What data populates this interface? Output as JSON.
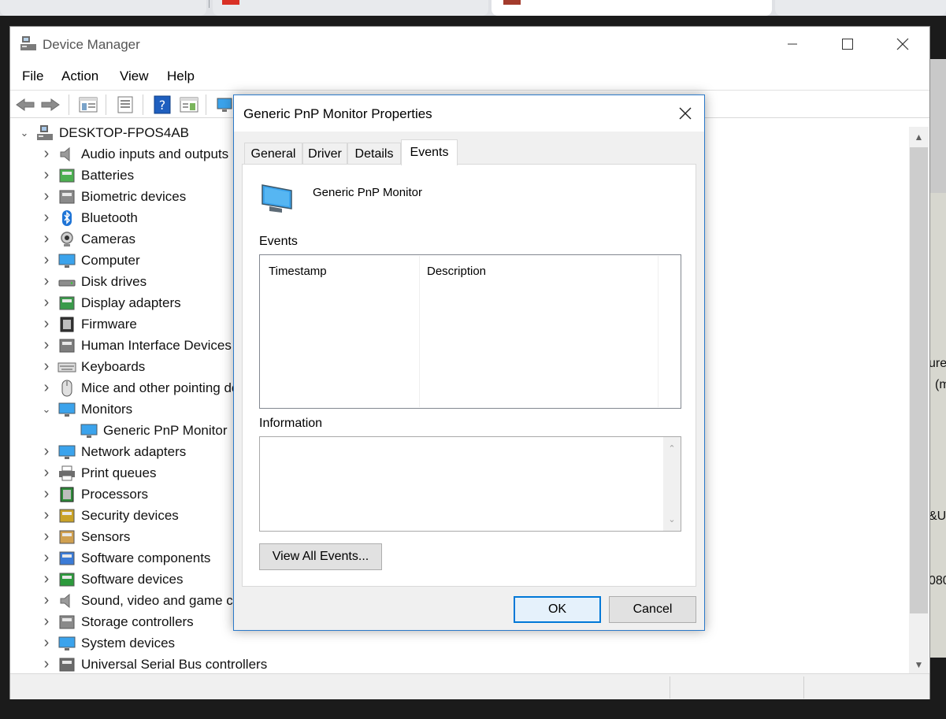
{
  "window": {
    "title": "Device Manager",
    "menus": [
      "File",
      "Action",
      "View",
      "Help"
    ]
  },
  "tree": {
    "root": "DESKTOP-FPOS4AB",
    "items": [
      {
        "label": "Audio inputs and outputs",
        "icon": "speaker-icon",
        "expanded": false
      },
      {
        "label": "Batteries",
        "icon": "battery-icon",
        "expanded": false
      },
      {
        "label": "Biometric devices",
        "icon": "fingerprint-icon",
        "expanded": false
      },
      {
        "label": "Bluetooth",
        "icon": "bluetooth-icon",
        "expanded": false
      },
      {
        "label": "Cameras",
        "icon": "camera-icon",
        "expanded": false
      },
      {
        "label": "Computer",
        "icon": "computer-icon",
        "expanded": false
      },
      {
        "label": "Disk drives",
        "icon": "disk-drive-icon",
        "expanded": false
      },
      {
        "label": "Display adapters",
        "icon": "display-adapter-icon",
        "expanded": false
      },
      {
        "label": "Firmware",
        "icon": "chip-icon",
        "expanded": false
      },
      {
        "label": "Human Interface Devices",
        "icon": "hid-icon",
        "expanded": false
      },
      {
        "label": "Keyboards",
        "icon": "keyboard-icon",
        "expanded": false
      },
      {
        "label": "Mice and other pointing devices",
        "icon": "mouse-icon",
        "expanded": false
      },
      {
        "label": "Monitors",
        "icon": "monitor-icon",
        "expanded": true
      },
      {
        "label": "Generic PnP Monitor",
        "icon": "monitor-icon",
        "child": true
      },
      {
        "label": "Network adapters",
        "icon": "network-icon",
        "expanded": false
      },
      {
        "label": "Print queues",
        "icon": "printer-icon",
        "expanded": false
      },
      {
        "label": "Processors",
        "icon": "processor-icon",
        "expanded": false
      },
      {
        "label": "Security devices",
        "icon": "security-key-icon",
        "expanded": false
      },
      {
        "label": "Sensors",
        "icon": "sensor-icon",
        "expanded": false
      },
      {
        "label": "Software components",
        "icon": "software-component-icon",
        "expanded": false
      },
      {
        "label": "Software devices",
        "icon": "software-device-icon",
        "expanded": false
      },
      {
        "label": "Sound, video and game controllers",
        "icon": "speaker-icon",
        "expanded": false
      },
      {
        "label": "Storage controllers",
        "icon": "storage-controller-icon",
        "expanded": false
      },
      {
        "label": "System devices",
        "icon": "system-device-icon",
        "expanded": false
      },
      {
        "label": "Universal Serial Bus controllers",
        "icon": "usb-icon",
        "expanded": false
      }
    ]
  },
  "dialog": {
    "title": "Generic PnP Monitor Properties",
    "tabs": [
      "General",
      "Driver",
      "Details",
      "Events"
    ],
    "active_tab": "Events",
    "device_name": "Generic PnP Monitor",
    "events_label": "Events",
    "columns": [
      "Timestamp",
      "Description"
    ],
    "information_label": "Information",
    "view_all_button": "View All Events...",
    "ok_button": "OK",
    "cancel_button": "Cancel"
  },
  "background": {
    "snippets": [
      "ure",
      "(m",
      "&U",
      "080"
    ]
  },
  "colors": {
    "accent": "#0078d7",
    "dialog_border": "#2b79c9",
    "monitor_blue": "#3ba3ec"
  }
}
